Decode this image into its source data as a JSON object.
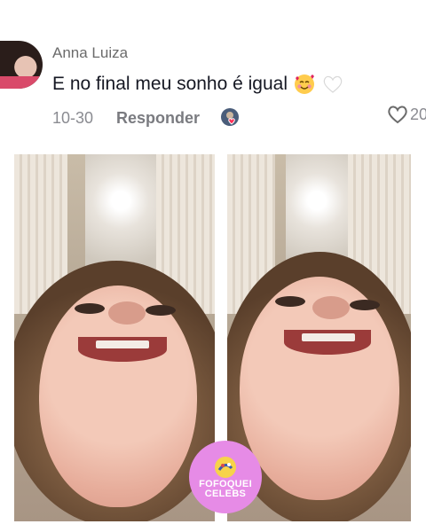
{
  "comment": {
    "username": "Anna Luiza",
    "text": "E no final meu sonho é igual",
    "emojis": [
      "smiling-face-with-hearts-emoji",
      "white-heart-emoji"
    ],
    "date": "10-30",
    "reply_label": "Responder",
    "like_count": "20"
  },
  "watermark": {
    "line1": "FOFOQUEI",
    "line2": "CELEBS",
    "color": "#e68be6"
  },
  "icons": {
    "like": "heart-outline-icon",
    "creator_liked": "creator-avatar-heart-icon"
  }
}
